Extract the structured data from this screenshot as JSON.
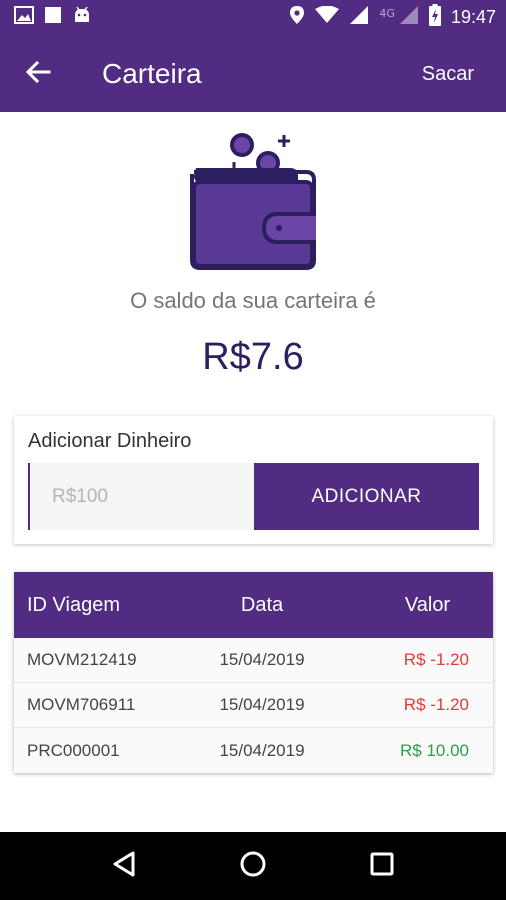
{
  "status_bar": {
    "time": "19:47",
    "network": "4G",
    "icons": [
      "image-icon",
      "square-icon",
      "android-icon",
      "location-icon",
      "wifi-icon",
      "signal-icon",
      "battery-icon"
    ]
  },
  "app_bar": {
    "title": "Carteira",
    "action_label": "Sacar"
  },
  "balance": {
    "caption": "O saldo da sua carteira é",
    "value": "R$7.6"
  },
  "add_money": {
    "label": "Adicionar Dinheiro",
    "input_value": "",
    "placeholder": "R$100",
    "button_label": "ADICIONAR"
  },
  "transactions": {
    "headers": [
      "ID Viagem",
      "Data",
      "Valor"
    ],
    "rows": [
      {
        "id": "MOVM212419",
        "date": "15/04/2019",
        "value": "R$ -1.20",
        "status": "negative"
      },
      {
        "id": "MOVM706911",
        "date": "15/04/2019",
        "value": "R$ -1.20",
        "status": "negative"
      },
      {
        "id": "PRC000001",
        "date": "15/04/2019",
        "value": "R$ 10.00",
        "status": "positive"
      }
    ]
  },
  "colors": {
    "primary": "#512c82",
    "balance_text": "#2d1e5f",
    "negative": "#e53935",
    "positive": "#2e9e47"
  }
}
